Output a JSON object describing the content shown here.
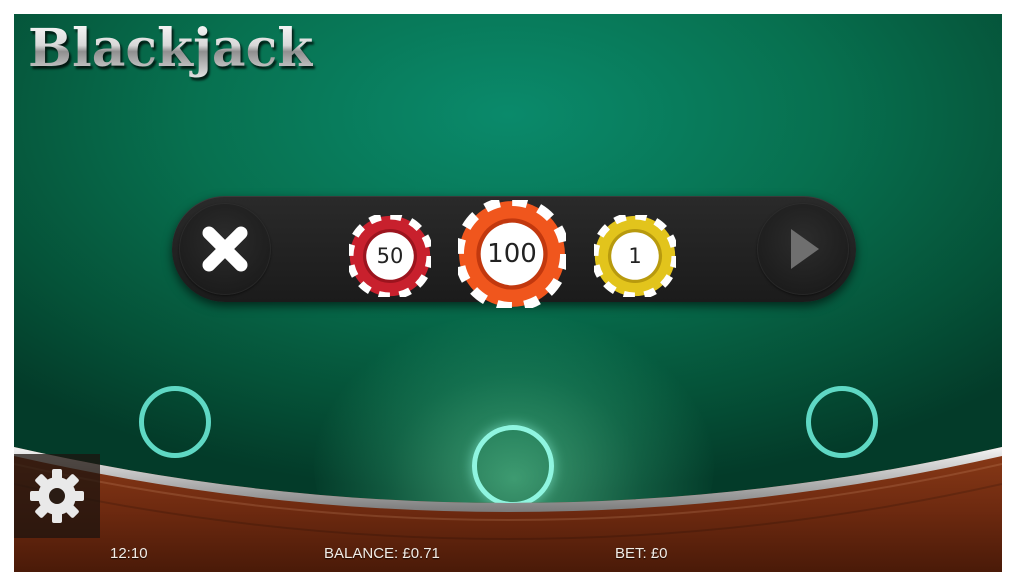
{
  "title": "Blackjack",
  "chips": [
    {
      "value": "50",
      "color": "#c8202d"
    },
    {
      "value": "100",
      "color": "#f0561d"
    },
    {
      "value": "1",
      "color": "#e2c41c"
    }
  ],
  "controls": {
    "close_icon": "close-icon",
    "play_icon": "play-icon",
    "settings_icon": "gear-icon"
  },
  "status": {
    "time": "12:10",
    "balance": "BALANCE: £0.71",
    "bet": "BET: £0"
  },
  "colors": {
    "felt": "#07704f",
    "bet_spot": "#5fd8c4",
    "rail": "#7a2e12"
  }
}
